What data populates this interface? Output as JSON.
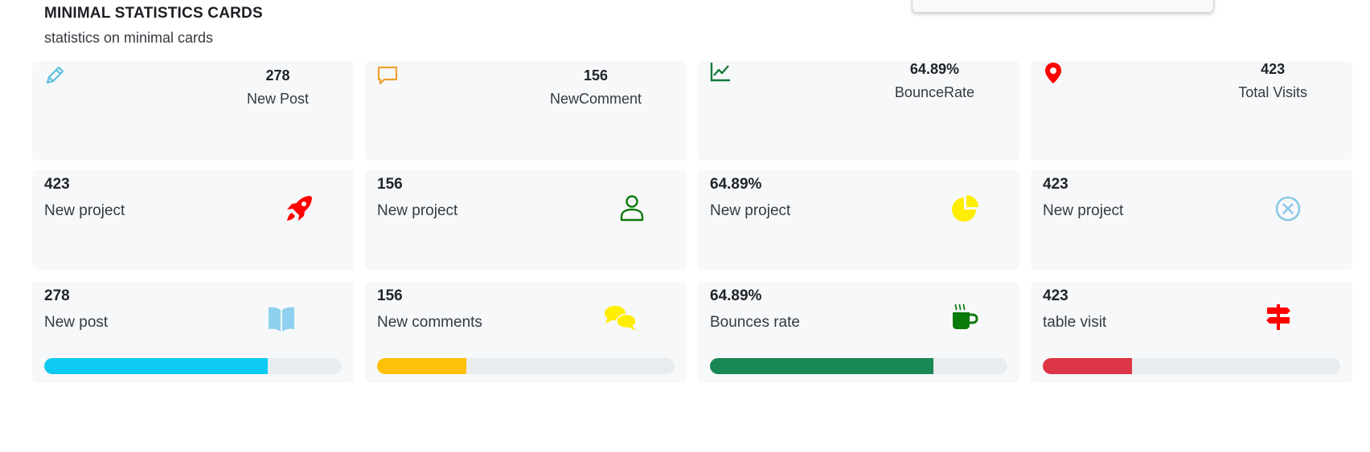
{
  "header": {
    "title": "MINIMAL STATISTICS CARDS",
    "subtitle": "statistics on minimal cards"
  },
  "row1": [
    {
      "value": "278",
      "label": "New Post",
      "icon": "pencil-icon",
      "color": "#5bc0de"
    },
    {
      "value": "156",
      "label": "NewComment",
      "icon": "comment-icon",
      "color": "#f0a030"
    },
    {
      "value": "64.89%",
      "label": "BounceRate",
      "icon": "line-chart-icon",
      "color": "#157a3c"
    },
    {
      "value": "423",
      "label": "Total Visits",
      "icon": "map-pin-icon",
      "color": "#ff0000"
    }
  ],
  "row2": [
    {
      "value": "423",
      "label": "New project",
      "icon": "rocket-icon",
      "color": "#ff0000"
    },
    {
      "value": "156",
      "label": "New project",
      "icon": "user-icon",
      "color": "#0a7a0a"
    },
    {
      "value": "64.89%",
      "label": "New project",
      "icon": "pie-chart-icon",
      "color": "#ffee00"
    },
    {
      "value": "423",
      "label": "New project",
      "icon": "circle-x-icon",
      "color": "#8bc8e8"
    }
  ],
  "row3": [
    {
      "value": "278",
      "label": "New post",
      "icon": "book-icon",
      "color": "#8fd0ee",
      "progress": 0.75,
      "bar_color": "#0dcaf0"
    },
    {
      "value": "156",
      "label": "New comments",
      "icon": "chat-bubbles-icon",
      "color": "#ffee00",
      "progress": 0.3,
      "bar_color": "#ffc107"
    },
    {
      "value": "64.89%",
      "label": "Bounces rate",
      "icon": "coffee-mug-icon",
      "color": "#0a7a0a",
      "progress": 0.75,
      "bar_color": "#198754"
    },
    {
      "value": "423",
      "label": "table visit",
      "icon": "signpost-icon",
      "color": "#ff0000",
      "progress": 0.3,
      "bar_color": "#dc3545"
    }
  ]
}
